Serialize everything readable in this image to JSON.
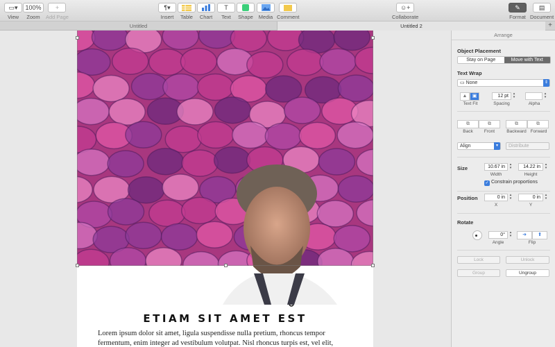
{
  "toolbar": {
    "view": "View",
    "zoom_value": "100%",
    "zoom": "Zoom",
    "add_page": "Add Page",
    "insert": "Insert",
    "table": "Table",
    "chart": "Chart",
    "text": "Text",
    "shape": "Shape",
    "media": "Media",
    "comment": "Comment",
    "collaborate": "Collaborate",
    "format": "Format",
    "document": "Document"
  },
  "tabs": [
    {
      "label": "Untitled"
    },
    {
      "label": "Untitled 2"
    }
  ],
  "document": {
    "title": "ETIAM SIT AMET EST",
    "body": "Lorem ipsum dolor sit amet, ligula suspendisse nulla pretium, rhoncus tempor fermentum, enim integer ad vestibulum volutpat. Nisl rhoncus turpis est, vel elit, congue wisi enim"
  },
  "inspector": {
    "tab": "Arrange",
    "object_placement": "Object Placement",
    "stay_on_page": "Stay on Page",
    "move_with_text": "Move with Text",
    "text_wrap": "Text Wrap",
    "wrap_value": "None",
    "text_fit": "Text Fit",
    "spacing_value": "12 pt",
    "spacing": "Spacing",
    "alpha": "Alpha",
    "back": "Back",
    "front": "Front",
    "backward": "Backward",
    "forward": "Forward",
    "align": "Align",
    "distribute": "Distribute",
    "size": "Size",
    "width_value": "10.67 in",
    "width": "Width",
    "height_value": "14.22 in",
    "height": "Height",
    "constrain": "Constrain proportions",
    "position": "Position",
    "x_value": "0 in",
    "x": "X",
    "y_value": "0 in",
    "y": "Y",
    "rotate": "Rotate",
    "angle_value": "0°",
    "angle": "Angle",
    "flip": "Flip",
    "lock": "Lock",
    "unlock": "Unlock",
    "group": "Group",
    "ungroup": "Ungroup"
  },
  "colors": {
    "accent": "#3b7ddd",
    "photo_pink": "#d23c96",
    "photo_purple": "#7a2a8c"
  }
}
